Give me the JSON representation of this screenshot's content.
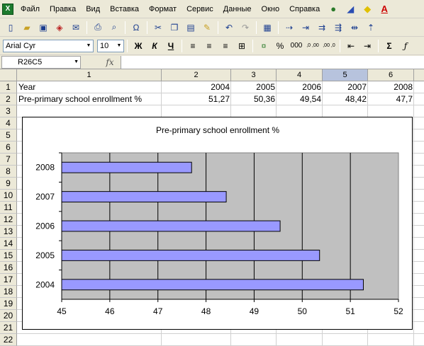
{
  "menu": [
    "Файл",
    "Правка",
    "Вид",
    "Вставка",
    "Формат",
    "Сервис",
    "Данные",
    "Окно",
    "Справка"
  ],
  "toolbar": {
    "font_name": "Arial Cyr",
    "font_size": "10",
    "bold": "Ж",
    "italic": "К",
    "underline": "Ч",
    "percent": "%",
    "thousands": "000",
    "dec_inc": ",0 ,00",
    "dec_dec": ",00 ,0",
    "sum": "Σ",
    "omega": "Ω"
  },
  "formula_bar": {
    "name_box": "R26C5",
    "fx_label": "fx",
    "formula": ""
  },
  "sheet": {
    "columns": [
      "1",
      "2",
      "3",
      "4",
      "5",
      "6"
    ],
    "selected_column": "5",
    "rows": [
      "1",
      "2",
      "3",
      "4",
      "5",
      "6",
      "7",
      "8",
      "9",
      "10",
      "11",
      "12",
      "13",
      "14",
      "15",
      "16",
      "17",
      "18",
      "19",
      "20",
      "21",
      "22"
    ],
    "row1": [
      "Year",
      "2004",
      "2005",
      "2006",
      "2007",
      "2008"
    ],
    "row2": [
      "Pre-primary school enrollment %",
      "51,27",
      "50,36",
      "49,54",
      "48,42",
      "47,7"
    ]
  },
  "colors": {
    "bar_fill": "#9999ff",
    "plot_bg": "#c0c0c0",
    "selected_header": "#b7c3dd"
  },
  "chart_data": {
    "type": "bar",
    "orientation": "horizontal",
    "title": "Pre-primary school enrollment %",
    "categories": [
      "2004",
      "2005",
      "2006",
      "2007",
      "2008"
    ],
    "values": [
      51.27,
      50.36,
      49.54,
      48.42,
      47.7
    ],
    "xlim": [
      45,
      52
    ],
    "xticks": [
      "45",
      "46",
      "47",
      "48",
      "49",
      "50",
      "51",
      "52"
    ],
    "grid": true,
    "legend": "none"
  }
}
